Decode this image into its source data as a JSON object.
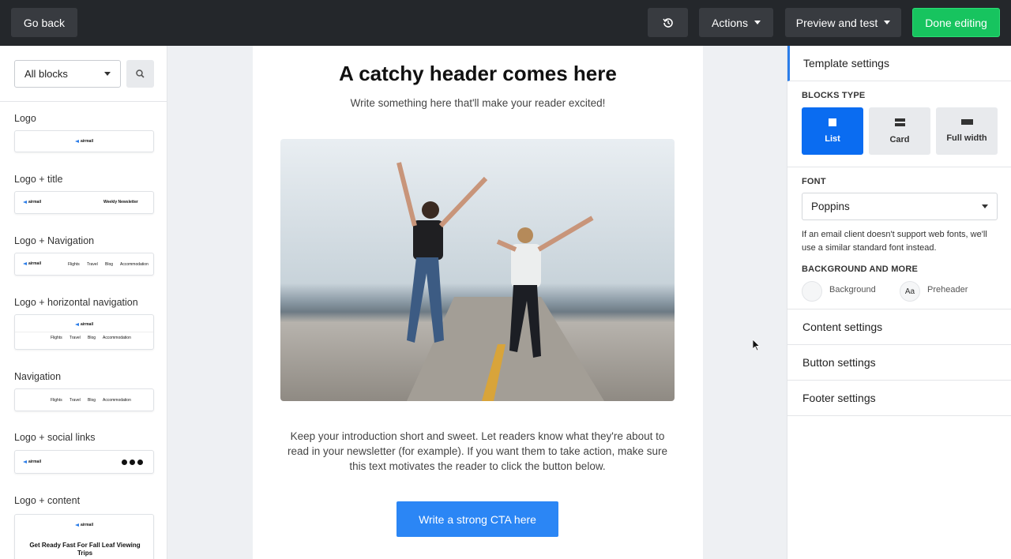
{
  "topbar": {
    "go_back": "Go back",
    "actions": "Actions",
    "preview": "Preview and test",
    "done": "Done editing"
  },
  "left": {
    "filter_value": "All blocks",
    "blocks": [
      {
        "label": "Logo"
      },
      {
        "label": "Logo + title",
        "preview_title": "Weekly Newsletter"
      },
      {
        "label": "Logo + Navigation"
      },
      {
        "label": "Logo + horizontal navigation"
      },
      {
        "label": "Navigation"
      },
      {
        "label": "Logo + social links"
      },
      {
        "label": "Logo + content",
        "preview_title": "Get Ready Fast For Fall Leaf Viewing Trips"
      }
    ],
    "mini_logo": "airmail",
    "mini_nav": [
      "Flights",
      "Travel",
      "Blog",
      "Accommodation"
    ]
  },
  "email": {
    "heading": "A catchy header comes here",
    "subheading": "Write something here that'll make your reader excited!",
    "body": "Keep your introduction short and sweet. Let readers know what they're about to read in your newsletter (for example). If you want them to take action, make sure this text motivates the reader to click the button below.",
    "cta": "Write a strong CTA here"
  },
  "right": {
    "template_settings": "Template settings",
    "blocks_type_label": "BLOCKS TYPE",
    "block_types": [
      "List",
      "Card",
      "Full width"
    ],
    "font_label": "FONT",
    "font_value": "Poppins",
    "font_note": "If an email client doesn't support web fonts, we'll use a similar standard font instead.",
    "bg_label": "BACKGROUND AND MORE",
    "background": "Background",
    "preheader": "Preheader",
    "preheader_icon": "Aa",
    "content_settings": "Content settings",
    "button_settings": "Button settings",
    "footer_settings": "Footer settings"
  },
  "colors": {
    "accent": "#0a6cf1",
    "done": "#17c45f",
    "cta": "#2b86f5",
    "topbar": "#24272b"
  }
}
